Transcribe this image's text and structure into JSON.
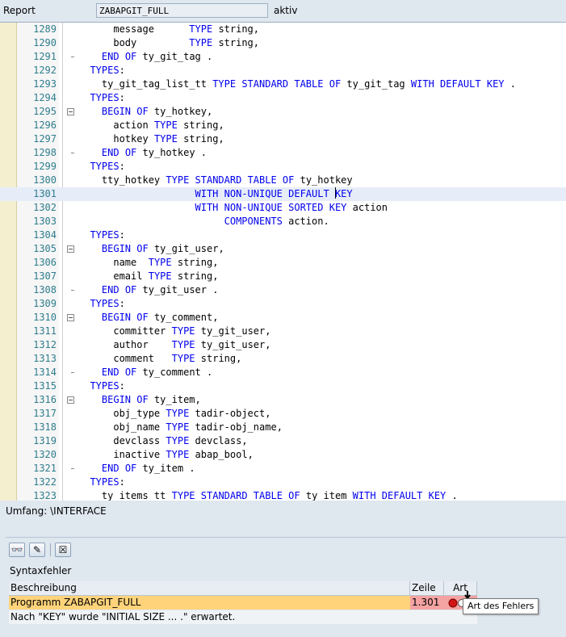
{
  "header": {
    "label": "Report",
    "program": "ZABAPGIT_FULL",
    "status": "aktiv"
  },
  "editor": {
    "current_line": "1301",
    "lines": [
      {
        "n": "1289",
        "t": "      message      TYPE string,"
      },
      {
        "n": "1290",
        "t": "      body         TYPE string,"
      },
      {
        "n": "1291",
        "t": "    END OF ty_git_tag .",
        "fold": "end"
      },
      {
        "n": "1292",
        "t": "  TYPES:"
      },
      {
        "n": "1293",
        "t": "    ty_git_tag_list_tt TYPE STANDARD TABLE OF ty_git_tag WITH DEFAULT KEY ."
      },
      {
        "n": "1294",
        "t": "  TYPES:"
      },
      {
        "n": "1295",
        "t": "    BEGIN OF ty_hotkey,",
        "fold": "start"
      },
      {
        "n": "1296",
        "t": "      action TYPE string,"
      },
      {
        "n": "1297",
        "t": "      hotkey TYPE string,"
      },
      {
        "n": "1298",
        "t": "    END OF ty_hotkey .",
        "fold": "end"
      },
      {
        "n": "1299",
        "t": "  TYPES:"
      },
      {
        "n": "1300",
        "t": "    tty_hotkey TYPE STANDARD TABLE OF ty_hotkey"
      },
      {
        "n": "1301",
        "t": "                    WITH NON-UNIQUE DEFAULT KEY"
      },
      {
        "n": "1302",
        "t": "                    WITH NON-UNIQUE SORTED KEY action"
      },
      {
        "n": "1303",
        "t": "                         COMPONENTS action."
      },
      {
        "n": "1304",
        "t": "  TYPES:"
      },
      {
        "n": "1305",
        "t": "    BEGIN OF ty_git_user,",
        "fold": "start"
      },
      {
        "n": "1306",
        "t": "      name  TYPE string,"
      },
      {
        "n": "1307",
        "t": "      email TYPE string,"
      },
      {
        "n": "1308",
        "t": "    END OF ty_git_user .",
        "fold": "end"
      },
      {
        "n": "1309",
        "t": "  TYPES:"
      },
      {
        "n": "1310",
        "t": "    BEGIN OF ty_comment,",
        "fold": "start"
      },
      {
        "n": "1311",
        "t": "      committer TYPE ty_git_user,"
      },
      {
        "n": "1312",
        "t": "      author    TYPE ty_git_user,"
      },
      {
        "n": "1313",
        "t": "      comment   TYPE string,"
      },
      {
        "n": "1314",
        "t": "    END OF ty_comment .",
        "fold": "end"
      },
      {
        "n": "1315",
        "t": "  TYPES:"
      },
      {
        "n": "1316",
        "t": "    BEGIN OF ty_item,",
        "fold": "start"
      },
      {
        "n": "1317",
        "t": "      obj_type TYPE tadir-object,"
      },
      {
        "n": "1318",
        "t": "      obj_name TYPE tadir-obj_name,"
      },
      {
        "n": "1319",
        "t": "      devclass TYPE devclass,"
      },
      {
        "n": "1320",
        "t": "      inactive TYPE abap_bool,"
      },
      {
        "n": "1321",
        "t": "    END OF ty_item .",
        "fold": "end"
      },
      {
        "n": "1322",
        "t": "  TYPES:"
      },
      {
        "n": "1323",
        "t": "    ty_items_tt TYPE STANDARD TABLE OF ty_item WITH DEFAULT KEY ."
      }
    ],
    "keywords": [
      "TYPES",
      "TYPE",
      "END",
      "OF",
      "BEGIN",
      "STANDARD",
      "TABLE",
      "WITH",
      "DEFAULT",
      "KEY",
      "NON-UNIQUE",
      "SORTED",
      "COMPONENTS"
    ]
  },
  "scope": "Umfang: \\INTERFACE",
  "panel": {
    "title": "Syntaxfehler",
    "toolbar": [
      {
        "name": "glasses-icon",
        "glyph": "👓"
      },
      {
        "name": "pencil-icon",
        "glyph": "✎"
      },
      {
        "name": "close-box-icon",
        "glyph": "☒"
      }
    ],
    "columns": {
      "description": "Beschreibung",
      "line": "Zeile",
      "type": "Art"
    },
    "error": {
      "description": "Programm ZABAPGIT_FULL",
      "line": "1.301"
    },
    "message": "Nach \"KEY\" wurde \"INITIAL SIZE ... .\" erwartet.",
    "tooltip": "Art des Fehlers"
  },
  "colors": {
    "keyword": "#0000ee",
    "line_number": "#2e7d8d",
    "error_row": "#ffd37a",
    "error_cell": "#f4a2a2"
  }
}
